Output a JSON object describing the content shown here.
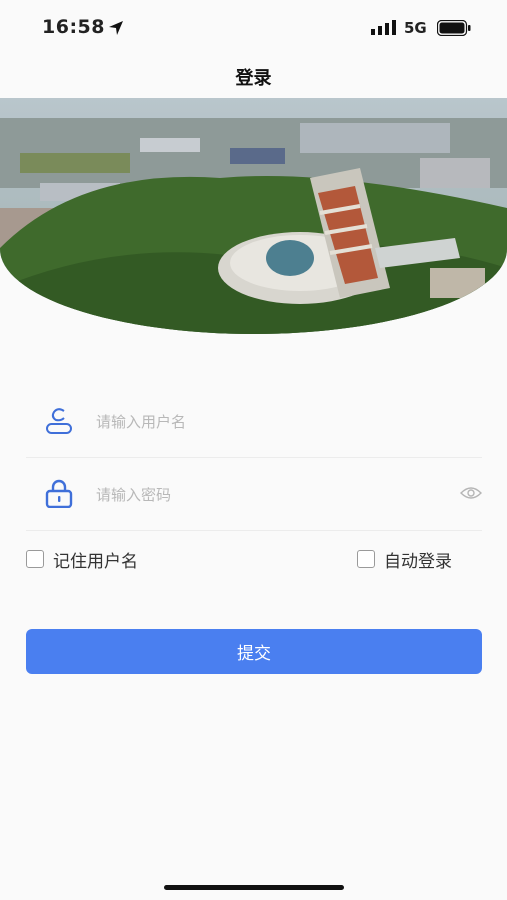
{
  "status_bar": {
    "time": "16:58",
    "network": "5G"
  },
  "nav": {
    "title": "登录"
  },
  "form": {
    "username_placeholder": "请输入用户名",
    "password_placeholder": "请输入密码",
    "remember_label": "记住用户名",
    "auto_login_label": "自动登录",
    "submit_label": "提交"
  },
  "icons": [
    "location-arrow-icon",
    "signal-icon",
    "battery-icon",
    "user-icon",
    "lock-icon",
    "eye-icon"
  ],
  "colors": {
    "accent": "#4a7ff0",
    "icon_blue": "#3f6fd9",
    "background": "#fafafa"
  }
}
